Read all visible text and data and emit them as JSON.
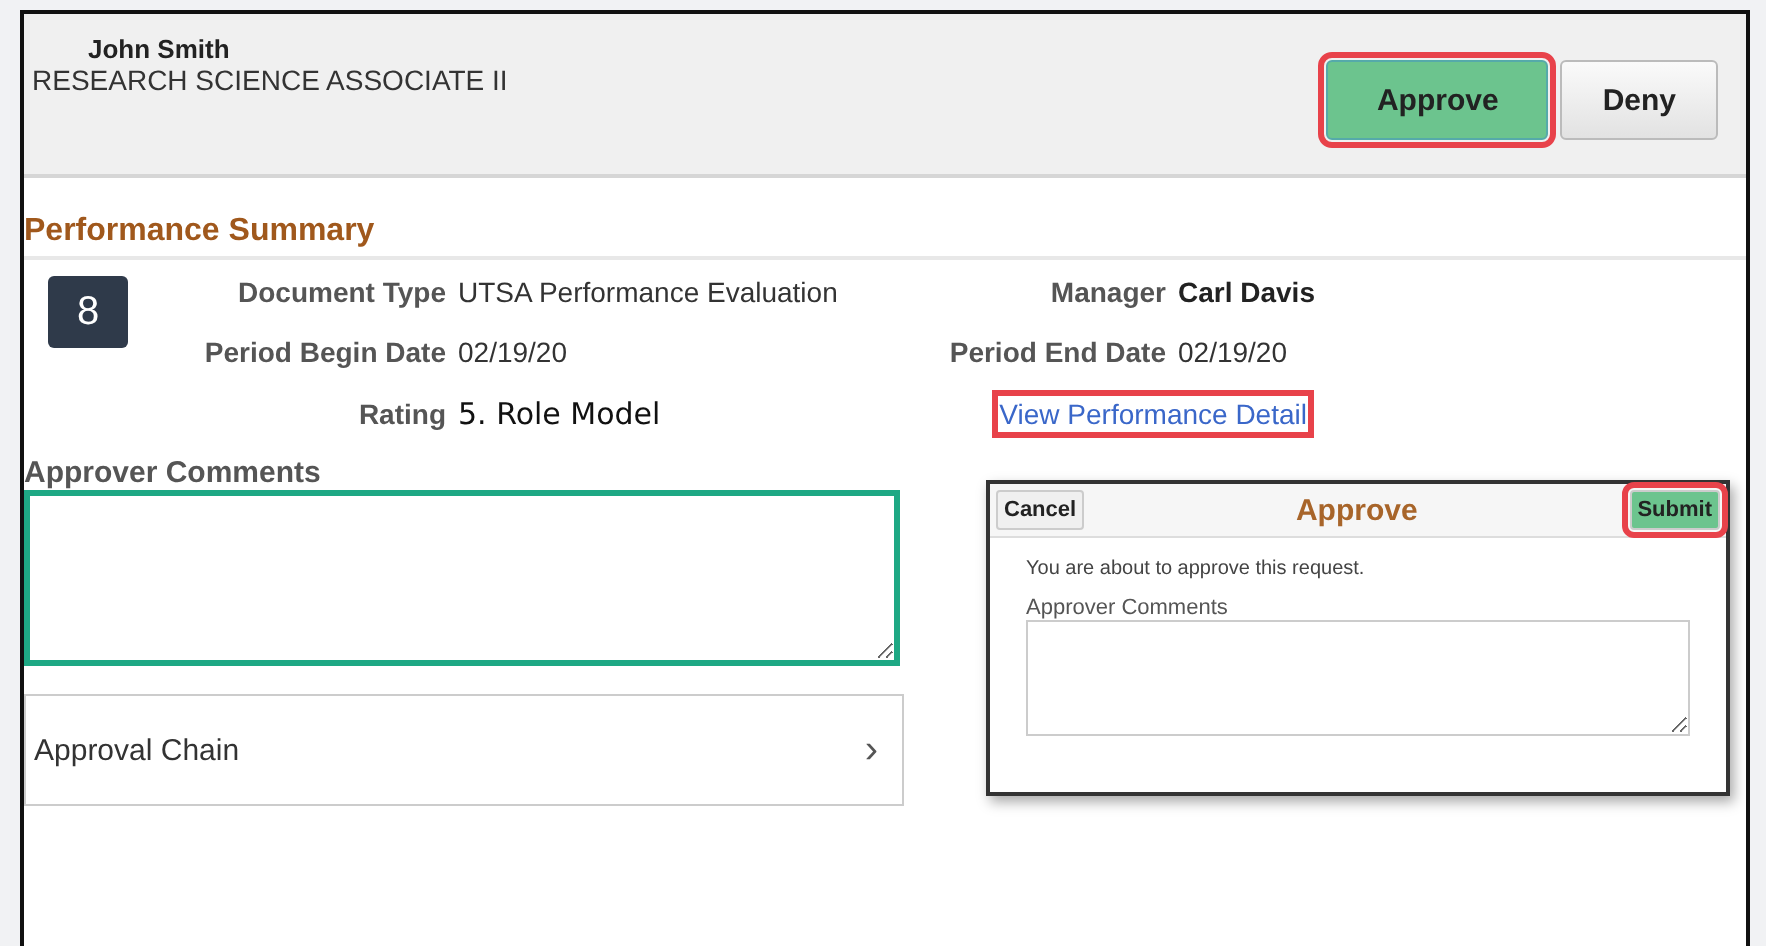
{
  "header": {
    "name": "John Smith",
    "job_title": "RESEARCH SCIENCE ASSOCIATE II",
    "buttons": [
      {
        "label": "Approve",
        "kind": "primary",
        "highlighted": true
      },
      {
        "label": "Deny",
        "kind": "secondary",
        "highlighted": false
      }
    ]
  },
  "section_title": "Performance Summary",
  "badge": "8",
  "fields": [
    {
      "label": "Document Type",
      "value": "UTSA Performance Evaluation"
    },
    {
      "label": "Manager",
      "value": "Carl Davis",
      "bold": true
    },
    {
      "label": "Period Begin Date",
      "value": "02/19/20"
    },
    {
      "label": "Period End Date",
      "value": "02/19/20"
    },
    {
      "label": "Rating",
      "value": "5. Role Model",
      "kind": "plain"
    }
  ],
  "detail_link": {
    "label": "View Performance Detail",
    "highlighted": true
  },
  "comments": {
    "label": "Approver Comments",
    "focused": true
  },
  "approval_chain": {
    "label": "Approval Chain",
    "icon": "›"
  },
  "dialog": {
    "title": "Approve",
    "cancel": {
      "label": "Cancel",
      "highlighted": false
    },
    "submit": {
      "label": "Submit",
      "highlighted": true
    },
    "message": "You are about to approve this request.",
    "comments_label": "Approver Comments"
  }
}
